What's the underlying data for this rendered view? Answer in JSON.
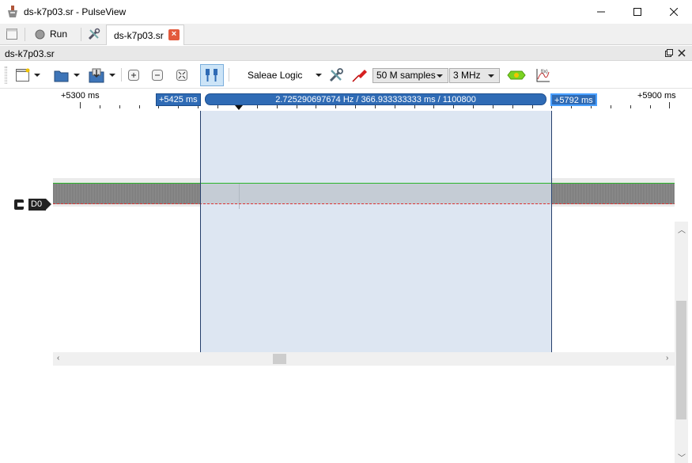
{
  "window": {
    "title": "ds-k7p03.sr - PulseView",
    "minimize": "minimize",
    "maximize": "maximize",
    "close": "close"
  },
  "tabbar": {
    "run_label": "Run",
    "session_tab": "ds-k7p03.sr",
    "session_tab_close": "×"
  },
  "dock": {
    "title": "ds-k7p03.sr"
  },
  "toolbar": {
    "device": "Saleae Logic",
    "sample_count": "50 M samples",
    "sample_rate": "3 MHz"
  },
  "ruler": {
    "left_label": "+5300 ms",
    "right_label": "+5900 ms",
    "cursor1_label": "+5425 ms",
    "cursor2_label": "+5792 ms",
    "cursor_measure": "2.725290697674 Hz / 366.933333333 ms / 1100800"
  },
  "channels": [
    {
      "name": "D0",
      "color": "#2ab52a"
    }
  ],
  "colors": {
    "selection_region": "#dde6f2",
    "cursor_flag": "#2f6bb5",
    "signal_high": "#2ab52a",
    "signal_low": "#dd3333"
  }
}
